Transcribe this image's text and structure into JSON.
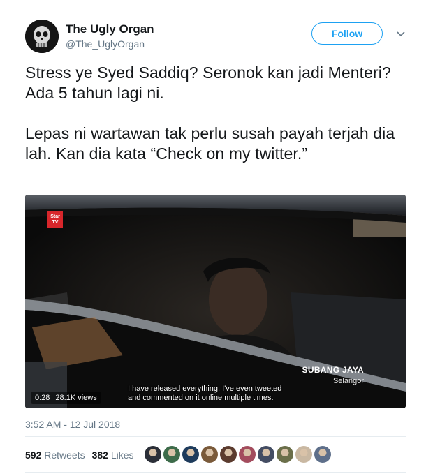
{
  "user": {
    "display_name": "The Ugly Organ",
    "handle": "@The_UglyOrgan",
    "follow_label": "Follow"
  },
  "tweet": {
    "paragraph1": "Stress ye Syed Saddiq? Seronok kan jadi Menteri? Ada 5 tahun lagi ni.",
    "paragraph2": "Lepas ni wartawan tak perlu susah payah terjah dia lah. Kan dia kata “Check on my twitter.”",
    "timestamp": "3:52 AM - 12 Jul 2018"
  },
  "video": {
    "logo_line1": "Star",
    "logo_line2": "TV",
    "location_title": "SUBANG JAYA",
    "location_sub": "Selangor",
    "subtitle_line1": "I have released everything. I've even tweeted",
    "subtitle_line2": "and commented on it online multiple times.",
    "duration": "0:28",
    "views": "28.1K views"
  },
  "stats": {
    "retweets_count": "592",
    "retweets_label": "Retweets",
    "likes_count": "382",
    "likes_label": "Likes"
  },
  "colors": {
    "accent": "#1da1f2",
    "text": "#14171a",
    "muted": "#657786",
    "liker_avatars": [
      "#2b2f38",
      "#3d6b4a",
      "#1e3b5c",
      "#7a5a3a",
      "#5b3b2e",
      "#a34c5d",
      "#444d63",
      "#6b6f4a",
      "#c9b8a2",
      "#5e6f8a"
    ]
  }
}
